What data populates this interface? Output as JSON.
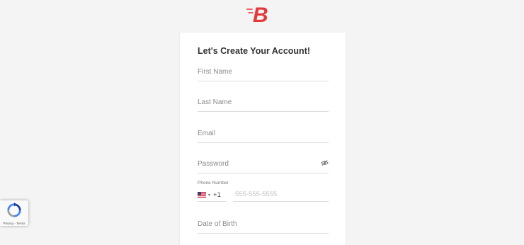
{
  "brand": {
    "logo_letter": "B",
    "color": "#e5383b"
  },
  "form": {
    "heading": "Let's Create Your Account!",
    "first_name": {
      "placeholder": "First Name",
      "value": ""
    },
    "last_name": {
      "placeholder": "Last Name",
      "value": ""
    },
    "email": {
      "placeholder": "Email",
      "value": ""
    },
    "password": {
      "placeholder": "Password",
      "value": "",
      "toggle_icon": "eye-off-icon"
    },
    "phone": {
      "label": "Phone Number",
      "country": "US",
      "flag_icon": "us-flag-icon",
      "caret": "▾",
      "dial_code": "+1",
      "placeholder": "555-555-5555"
    },
    "date_of_birth": {
      "placeholder": "Date of Birth",
      "value": ""
    }
  },
  "recaptcha": {
    "privacy": "Privacy",
    "separator": " - ",
    "terms": "Terms"
  }
}
